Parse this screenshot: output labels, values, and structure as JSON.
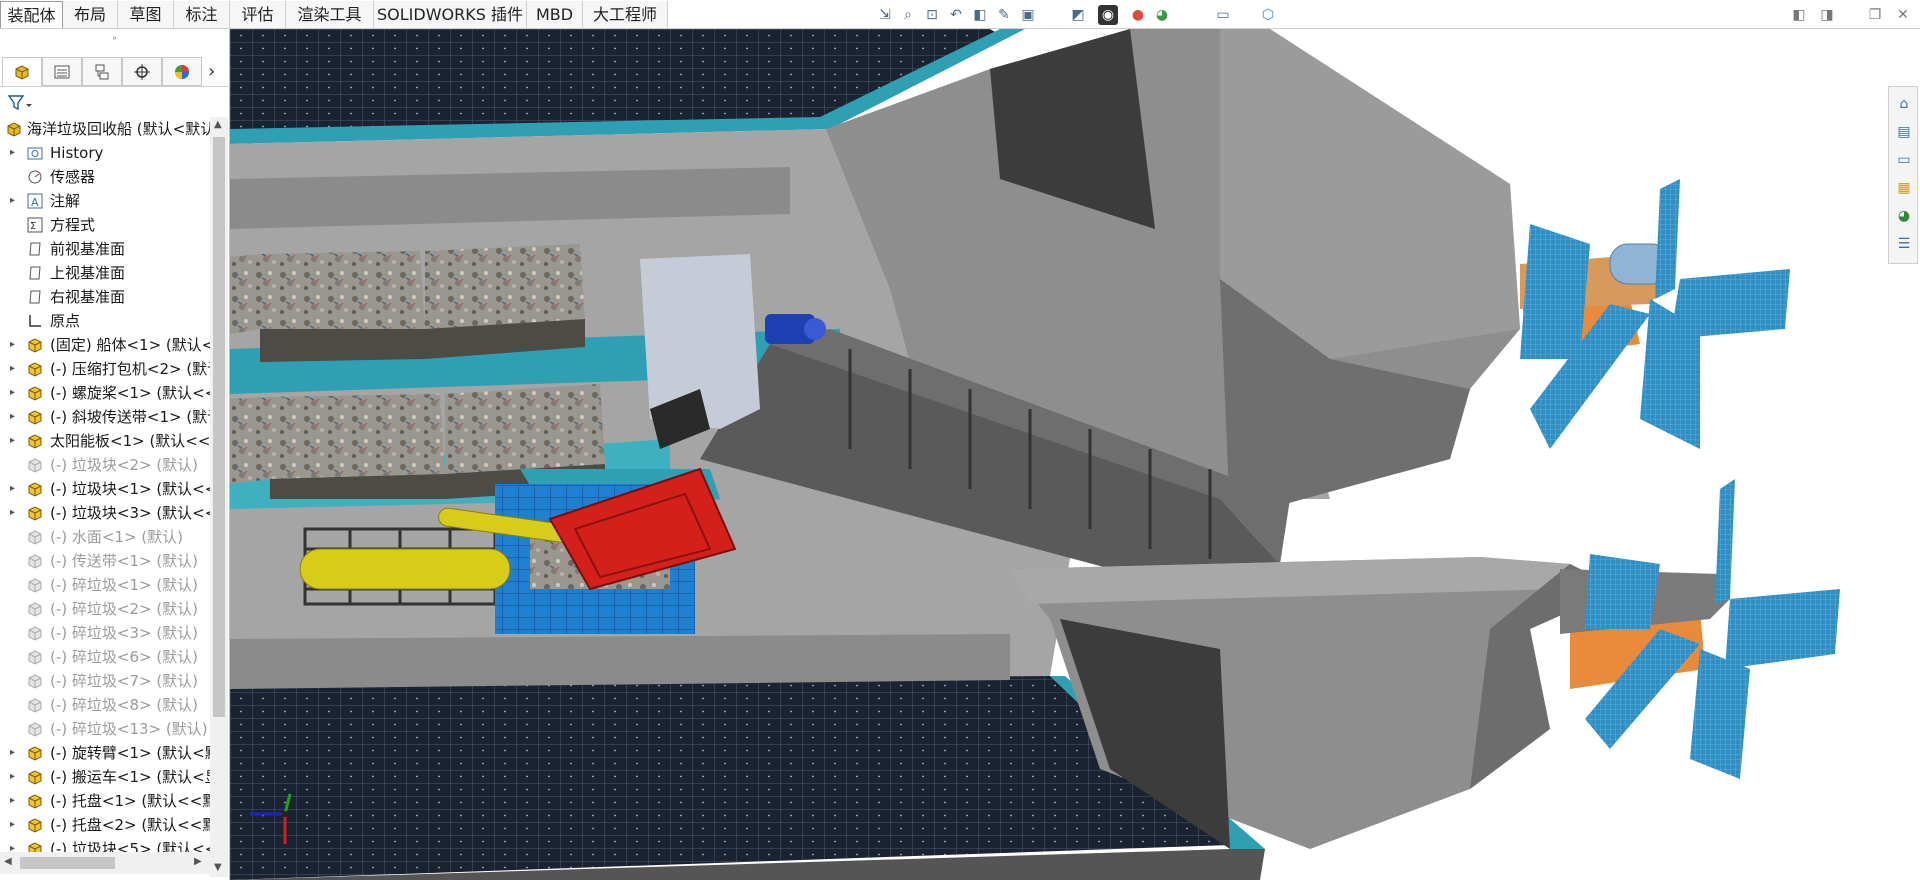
{
  "tabs": [
    {
      "label": "装配体",
      "active": true
    },
    {
      "label": "布局"
    },
    {
      "label": "草图"
    },
    {
      "label": "标注"
    },
    {
      "label": "评估"
    },
    {
      "label": "渲染工具"
    },
    {
      "label": "SOLIDWORKS 插件"
    },
    {
      "label": "MBD"
    },
    {
      "label": "大工程师"
    }
  ],
  "panel": {
    "grip": "°",
    "more": "›",
    "filter_icon": "funnel-icon"
  },
  "tree": [
    {
      "label": "海洋垃圾回收船 (默认<默认",
      "icon": "assembly-icon",
      "expander": "",
      "indent": 0,
      "state": "normal"
    },
    {
      "label": "History",
      "icon": "history-icon",
      "expander": "▸",
      "indent": 1,
      "state": "normal"
    },
    {
      "label": "传感器",
      "icon": "sensor-icon",
      "expander": "",
      "indent": 1,
      "state": "normal"
    },
    {
      "label": "注解",
      "icon": "annotation-icon",
      "expander": "▸",
      "indent": 1,
      "state": "normal"
    },
    {
      "label": "方程式",
      "icon": "equation-icon",
      "expander": "",
      "indent": 1,
      "state": "normal"
    },
    {
      "label": "前视基准面",
      "icon": "plane-icon",
      "expander": "",
      "indent": 1,
      "state": "normal"
    },
    {
      "label": "上视基准面",
      "icon": "plane-icon",
      "expander": "",
      "indent": 1,
      "state": "normal"
    },
    {
      "label": "右视基准面",
      "icon": "plane-icon",
      "expander": "",
      "indent": 1,
      "state": "normal"
    },
    {
      "label": "原点",
      "icon": "origin-icon",
      "expander": "",
      "indent": 1,
      "state": "normal"
    },
    {
      "label": "(固定) 船体<1> (默认<",
      "icon": "subassembly-icon",
      "expander": "▸",
      "indent": 1,
      "state": "normal"
    },
    {
      "label": "(-) 压缩打包机<2> (默认",
      "icon": "subassembly-icon",
      "expander": "▸",
      "indent": 1,
      "state": "normal"
    },
    {
      "label": "(-) 螺旋桨<1> (默认<<",
      "icon": "subassembly-icon",
      "expander": "▸",
      "indent": 1,
      "state": "normal"
    },
    {
      "label": "(-) 斜坡传送带<1> (默认",
      "icon": "subassembly-icon",
      "expander": "▸",
      "indent": 1,
      "state": "normal"
    },
    {
      "label": "太阳能板<1> (默认<<默",
      "icon": "subassembly-icon",
      "expander": "▸",
      "indent": 1,
      "state": "normal"
    },
    {
      "label": "(-) 垃圾块<2> (默认)",
      "icon": "suppressed-part-icon",
      "expander": "",
      "indent": 1,
      "state": "dim"
    },
    {
      "label": "(-) 垃圾块<1> (默认<<",
      "icon": "subassembly-icon",
      "expander": "▸",
      "indent": 1,
      "state": "normal"
    },
    {
      "label": "(-) 垃圾块<3> (默认<<",
      "icon": "subassembly-icon",
      "expander": "▸",
      "indent": 1,
      "state": "normal"
    },
    {
      "label": "(-) 水面<1> (默认)",
      "icon": "suppressed-part-icon",
      "expander": "",
      "indent": 1,
      "state": "dim"
    },
    {
      "label": "(-) 传送带<1> (默认)",
      "icon": "suppressed-part-icon",
      "expander": "",
      "indent": 1,
      "state": "dim"
    },
    {
      "label": "(-) 碎垃圾<1> (默认)",
      "icon": "suppressed-part-icon",
      "expander": "",
      "indent": 1,
      "state": "dim"
    },
    {
      "label": "(-) 碎垃圾<2> (默认)",
      "icon": "suppressed-part-icon",
      "expander": "",
      "indent": 1,
      "state": "dim"
    },
    {
      "label": "(-) 碎垃圾<3> (默认)",
      "icon": "suppressed-part-icon",
      "expander": "",
      "indent": 1,
      "state": "dim"
    },
    {
      "label": "(-) 碎垃圾<6> (默认)",
      "icon": "suppressed-part-icon",
      "expander": "",
      "indent": 1,
      "state": "dim"
    },
    {
      "label": "(-) 碎垃圾<7> (默认)",
      "icon": "suppressed-part-icon",
      "expander": "",
      "indent": 1,
      "state": "dim"
    },
    {
      "label": "(-) 碎垃圾<8> (默认)",
      "icon": "suppressed-part-icon",
      "expander": "",
      "indent": 1,
      "state": "dim"
    },
    {
      "label": "(-) 碎垃圾<13> (默认)",
      "icon": "suppressed-part-icon",
      "expander": "",
      "indent": 1,
      "state": "dim"
    },
    {
      "label": "(-) 旋转臂<1> (默认<默",
      "icon": "subassembly-icon",
      "expander": "▸",
      "indent": 1,
      "state": "normal"
    },
    {
      "label": "(-) 搬运车<1> (默认<显",
      "icon": "subassembly-icon",
      "expander": "▸",
      "indent": 1,
      "state": "normal"
    },
    {
      "label": "(-) 托盘<1> (默认<<默",
      "icon": "subassembly-icon",
      "expander": "▸",
      "indent": 1,
      "state": "normal"
    },
    {
      "label": "(-) 托盘<2> (默认<<默",
      "icon": "subassembly-icon",
      "expander": "▸",
      "indent": 1,
      "state": "normal"
    },
    {
      "label": "(-) 垃圾块<5> (默认<<",
      "icon": "subassembly-icon",
      "expander": "▸",
      "indent": 1,
      "state": "normal"
    }
  ],
  "colors": {
    "hull_gray": "#8e8e8e",
    "hull_dark": "#4a4a4a",
    "deck_teal": "#2f9fb3",
    "solar_dark": "#1b2232",
    "propeller_blue": "#2f8fc4",
    "orange_part": "#e9893a",
    "press_red": "#d4201b",
    "ram_yellow": "#d8cc1a",
    "frame_blue": "#1f7fd0",
    "motor_blue": "#1f3fb5"
  }
}
